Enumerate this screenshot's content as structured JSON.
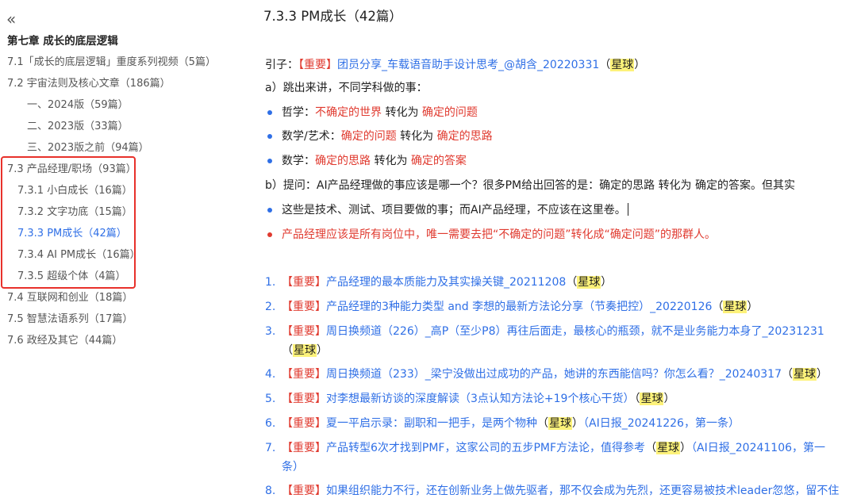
{
  "sidebar": {
    "collapse_icon": "«",
    "chapter_title": "第七章 成长的底层逻辑",
    "items": [
      {
        "label": "7.1「成长的底层逻辑」重度系列视频（5篇）"
      },
      {
        "label": "7.2 宇宙法则及核心文章（186篇）"
      },
      {
        "label": "一、2024版（59篇）"
      },
      {
        "label": "二、2023版（33篇）"
      },
      {
        "label": "三、2023版之前（94篇）"
      },
      {
        "label": "7.3 产品经理/职场（93篇）"
      },
      {
        "label": "7.3.1 小白成长（16篇）"
      },
      {
        "label": "7.3.2 文字功底（15篇）"
      },
      {
        "label": "7.3.3 PM成长（42篇）",
        "active": true
      },
      {
        "label": "7.3.4 AI PM成长（16篇）"
      },
      {
        "label": "7.3.5 超级个体（4篇）"
      },
      {
        "label": "7.4 互联网和创业（18篇）"
      },
      {
        "label": "7.5 智慧法语系列（17篇）"
      },
      {
        "label": "7.6 政经及其它（44篇）"
      }
    ],
    "highlight_color": "#e8312b"
  },
  "main": {
    "title": "7.3.3 PM成长（42篇）",
    "intro": {
      "prefix": "引子：",
      "important": "【重要】",
      "link": "团员分享_车载语音助手设计思考_@胡含_20220331",
      "star": "星球",
      "open": "（",
      "close": "）"
    },
    "section_a": "a）跳出来讲，不同学科做的事：",
    "a_items": [
      {
        "subject": "哲学：",
        "from": "不确定的世界",
        "verb": " 转化为 ",
        "to": "确定的问题"
      },
      {
        "subject": "数学/艺术：",
        "from": "确定的问题",
        "verb": " 转化为 ",
        "to": "确定的思路"
      },
      {
        "subject": "数学：",
        "from": "确定的思路",
        "verb": " 转化为 ",
        "to": "确定的答案"
      }
    ],
    "section_b": "b）提问：AI产品经理做的事应该是哪一个？很多PM给出回答的是：确定的思路 转化为 确定的答案。但其实",
    "b_item1": "这些是技术、测试、项目要做的事；而AI产品经理，不应该在这里卷。",
    "b_item2": "产品经理应该是所有岗位中，唯一需要去把“不确定的问题”转化成“确定问题”的那群人。",
    "articles": [
      {
        "num": "1.",
        "imp": "【重要】",
        "title": "产品经理的最本质能力及其实操关键_20211208",
        "star": "星球",
        "tail": ""
      },
      {
        "num": "2.",
        "imp": "【重要】",
        "title": "产品经理的3种能力类型 and 李想的最新方法论分享（节奏把控）_20220126",
        "star": "星球",
        "tail": ""
      },
      {
        "num": "3.",
        "imp": "【重要】",
        "title": "周日换频道（226）_高P（至少P8）再往后面走，最核心的瓶颈，就不是业务能力本身了_20231231",
        "star": "星球",
        "tail": ""
      },
      {
        "num": "4.",
        "imp": "【重要】",
        "title": "周日换频道（233）_梁宁没做出过成功的产品，她讲的东西能信吗？你怎么看？_20240317",
        "star": "星球",
        "tail": ""
      },
      {
        "num": "5.",
        "imp": "【重要】",
        "title": "对李想最新访谈的深度解读（3点认知方法论+19个核心干货）",
        "star": "星球",
        "tail": ""
      },
      {
        "num": "6.",
        "imp": "【重要】",
        "title": "夏一平启示录：副职和一把手，是两个物种",
        "star": "星球",
        "tail": "（AI日报_20241226，第一条）"
      },
      {
        "num": "7.",
        "imp": "【重要】",
        "title": "产品转型6次才找到PMF，这家公司的五步PMF方法论，值得参考",
        "star": "星球",
        "tail": "（AI日报_20241106，第一条）"
      },
      {
        "num": "8.",
        "imp": "【重要】",
        "title": "如果组织能力不行，还在创新业务上做先驱者，那不仅会成为先烈，还更容易被技术leader忽悠，留不住",
        "star": "",
        "tail": ""
      }
    ],
    "colors": {
      "link": "#2f6fe6",
      "important": "#e03a2f",
      "star_bg": "#fdf27a"
    }
  }
}
